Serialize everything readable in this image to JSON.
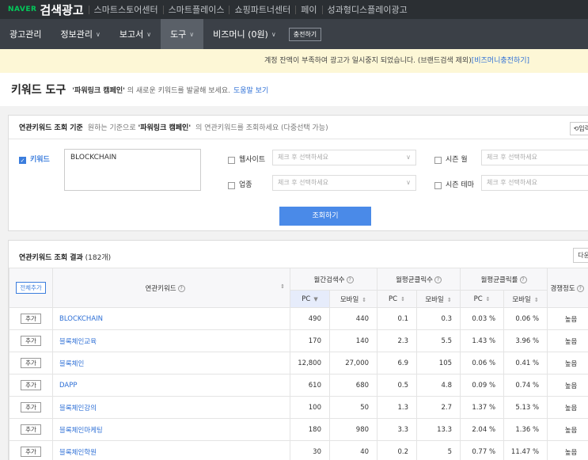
{
  "topbar": {
    "naver": "NAVER",
    "brand": "검색광고",
    "services": [
      "스마트스토어센터",
      "스마트플레이스",
      "쇼핑파트너센터",
      "페이",
      "성과형디스플레이광고"
    ]
  },
  "nav": {
    "items": [
      {
        "label": "광고관리"
      },
      {
        "label": "정보관리"
      },
      {
        "label": "보고서"
      },
      {
        "label": "도구"
      },
      {
        "label": "비즈머니 (0원)"
      }
    ],
    "charge_label": "충전하기"
  },
  "notice": {
    "text": "계정 잔액이 부족하여 광고가 일시중지 되었습니다. (브랜드검색 제외)",
    "link": "[비즈머니충전하기]"
  },
  "page": {
    "title": "키워드 도구",
    "desc_quote": "'파워링크 캠페인'",
    "desc_rest": " 의 새로운 키워드를 발굴해 보세요.",
    "help_link": "도움말 보기"
  },
  "criteria": {
    "title": "연관키워드 조회 기준",
    "hint_prefix": "원하는 기준으로 ",
    "hint_quote": "'파워링크 캠페인'",
    "hint_suffix": "의 연관키워드를 조회하세요 (다중선택 가능)",
    "reset_label": "⟲입력",
    "keyword_label": "키워드",
    "keyword_value": "BLOCKCHAIN",
    "website_label": "웹사이트",
    "industry_label": "업종",
    "season_month_label": "시즌 월",
    "season_theme_label": "시즌 테마",
    "select_placeholder": "체크 후 선택하세요",
    "search_button": "조회하기"
  },
  "results": {
    "title": "연관키워드 조회 결과",
    "count": "(182개)",
    "download_label": "다운",
    "headers": {
      "add_all": "전체추가",
      "keyword": "연관키워드",
      "monthly_search": "월간검색수",
      "monthly_click": "월평균클릭수",
      "monthly_ctr": "월평균클릭률",
      "competition": "경쟁정도",
      "pc": "PC",
      "mobile": "모바일"
    },
    "add_label": "추가",
    "rows": [
      {
        "keyword": "BLOCKCHAIN",
        "search_pc": "490",
        "search_mobile": "440",
        "click_pc": "0.1",
        "click_mobile": "0.3",
        "ctr_pc": "0.03 %",
        "ctr_mobile": "0.06 %",
        "competition": "높음"
      },
      {
        "keyword": "블록체인교육",
        "search_pc": "170",
        "search_mobile": "140",
        "click_pc": "2.3",
        "click_mobile": "5.5",
        "ctr_pc": "1.43 %",
        "ctr_mobile": "3.96 %",
        "competition": "높음"
      },
      {
        "keyword": "블록체인",
        "search_pc": "12,800",
        "search_mobile": "27,000",
        "click_pc": "6.9",
        "click_mobile": "105",
        "ctr_pc": "0.06 %",
        "ctr_mobile": "0.41 %",
        "competition": "높음"
      },
      {
        "keyword": "DAPP",
        "search_pc": "610",
        "search_mobile": "680",
        "click_pc": "0.5",
        "click_mobile": "4.8",
        "ctr_pc": "0.09 %",
        "ctr_mobile": "0.74 %",
        "competition": "높음"
      },
      {
        "keyword": "블록체인강의",
        "search_pc": "100",
        "search_mobile": "50",
        "click_pc": "1.3",
        "click_mobile": "2.7",
        "ctr_pc": "1.37 %",
        "ctr_mobile": "5.13 %",
        "competition": "높음"
      },
      {
        "keyword": "블록체인마케팅",
        "search_pc": "180",
        "search_mobile": "980",
        "click_pc": "3.3",
        "click_mobile": "13.3",
        "ctr_pc": "2.04 %",
        "ctr_mobile": "1.36 %",
        "competition": "높음"
      },
      {
        "keyword": "블록체인학원",
        "search_pc": "30",
        "search_mobile": "40",
        "click_pc": "0.2",
        "click_mobile": "5",
        "ctr_pc": "0.77 %",
        "ctr_mobile": "11.47 %",
        "competition": "높음"
      }
    ]
  }
}
